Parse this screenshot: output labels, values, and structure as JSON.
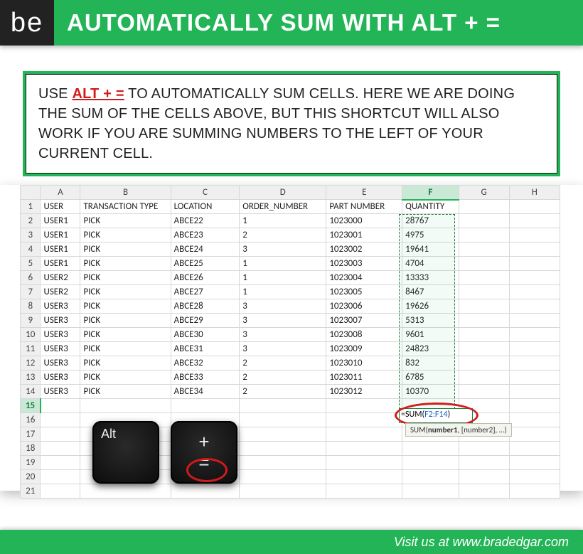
{
  "banner": {
    "logo": "be",
    "title": "AUTOMATICALLY SUM WITH ALT + ="
  },
  "tip": {
    "pre": "USE ",
    "keyword": "ALT + =",
    "post": " TO AUTOMATICALLY SUM CELLS.  HERE WE ARE DOING THE SUM OF THE CELLS ABOVE, BUT THIS SHORTCUT WILL ALSO WORK IF YOU ARE SUMMING NUMBERS TO THE LEFT OF YOUR CURRENT CELL."
  },
  "columns": [
    "A",
    "B",
    "C",
    "D",
    "E",
    "F",
    "G",
    "H"
  ],
  "headers": {
    "A": "USER",
    "B": "TRANSACTION TYPE",
    "C": "LOCATION",
    "D": "ORDER_NUMBER",
    "E": "PART NUMBER",
    "F": "QUANTITY"
  },
  "rows": [
    {
      "n": 1
    },
    {
      "n": 2,
      "A": "USER1",
      "B": "PICK",
      "C": "ABCE22",
      "D": "1",
      "E": "1023000",
      "F": "28767"
    },
    {
      "n": 3,
      "A": "USER1",
      "B": "PICK",
      "C": "ABCE23",
      "D": "2",
      "E": "1023001",
      "F": "4975"
    },
    {
      "n": 4,
      "A": "USER1",
      "B": "PICK",
      "C": "ABCE24",
      "D": "3",
      "E": "1023002",
      "F": "19641"
    },
    {
      "n": 5,
      "A": "USER1",
      "B": "PICK",
      "C": "ABCE25",
      "D": "1",
      "E": "1023003",
      "F": "4704"
    },
    {
      "n": 6,
      "A": "USER2",
      "B": "PICK",
      "C": "ABCE26",
      "D": "1",
      "E": "1023004",
      "F": "13333"
    },
    {
      "n": 7,
      "A": "USER2",
      "B": "PICK",
      "C": "ABCE27",
      "D": "1",
      "E": "1023005",
      "F": "8467"
    },
    {
      "n": 8,
      "A": "USER3",
      "B": "PICK",
      "C": "ABCE28",
      "D": "3",
      "E": "1023006",
      "F": "19626"
    },
    {
      "n": 9,
      "A": "USER3",
      "B": "PICK",
      "C": "ABCE29",
      "D": "3",
      "E": "1023007",
      "F": "5313"
    },
    {
      "n": 10,
      "A": "USER3",
      "B": "PICK",
      "C": "ABCE30",
      "D": "3",
      "E": "1023008",
      "F": "9601"
    },
    {
      "n": 11,
      "A": "USER3",
      "B": "PICK",
      "C": "ABCE31",
      "D": "3",
      "E": "1023009",
      "F": "24823"
    },
    {
      "n": 12,
      "A": "USER3",
      "B": "PICK",
      "C": "ABCE32",
      "D": "2",
      "E": "1023010",
      "F": "832"
    },
    {
      "n": 13,
      "A": "USER3",
      "B": "PICK",
      "C": "ABCE33",
      "D": "2",
      "E": "1023011",
      "F": "6785"
    },
    {
      "n": 14,
      "A": "USER3",
      "B": "PICK",
      "C": "ABCE34",
      "D": "2",
      "E": "1023012",
      "F": "10370"
    },
    {
      "n": 15
    },
    {
      "n": 16
    },
    {
      "n": 17
    },
    {
      "n": 18
    },
    {
      "n": 19
    },
    {
      "n": 20
    },
    {
      "n": 21
    }
  ],
  "selection": {
    "active_col": "F",
    "active_row": 15,
    "formula_prefix": "=SUM(",
    "formula_range": "F2:F14",
    "formula_suffix": ")",
    "tooltip_html": "SUM(<b>number1</b>, [number2], …)"
  },
  "keys": {
    "alt": "Alt",
    "plus": "+",
    "equals": "="
  },
  "footer": {
    "text": "Visit us at www.bradedgar.com"
  }
}
